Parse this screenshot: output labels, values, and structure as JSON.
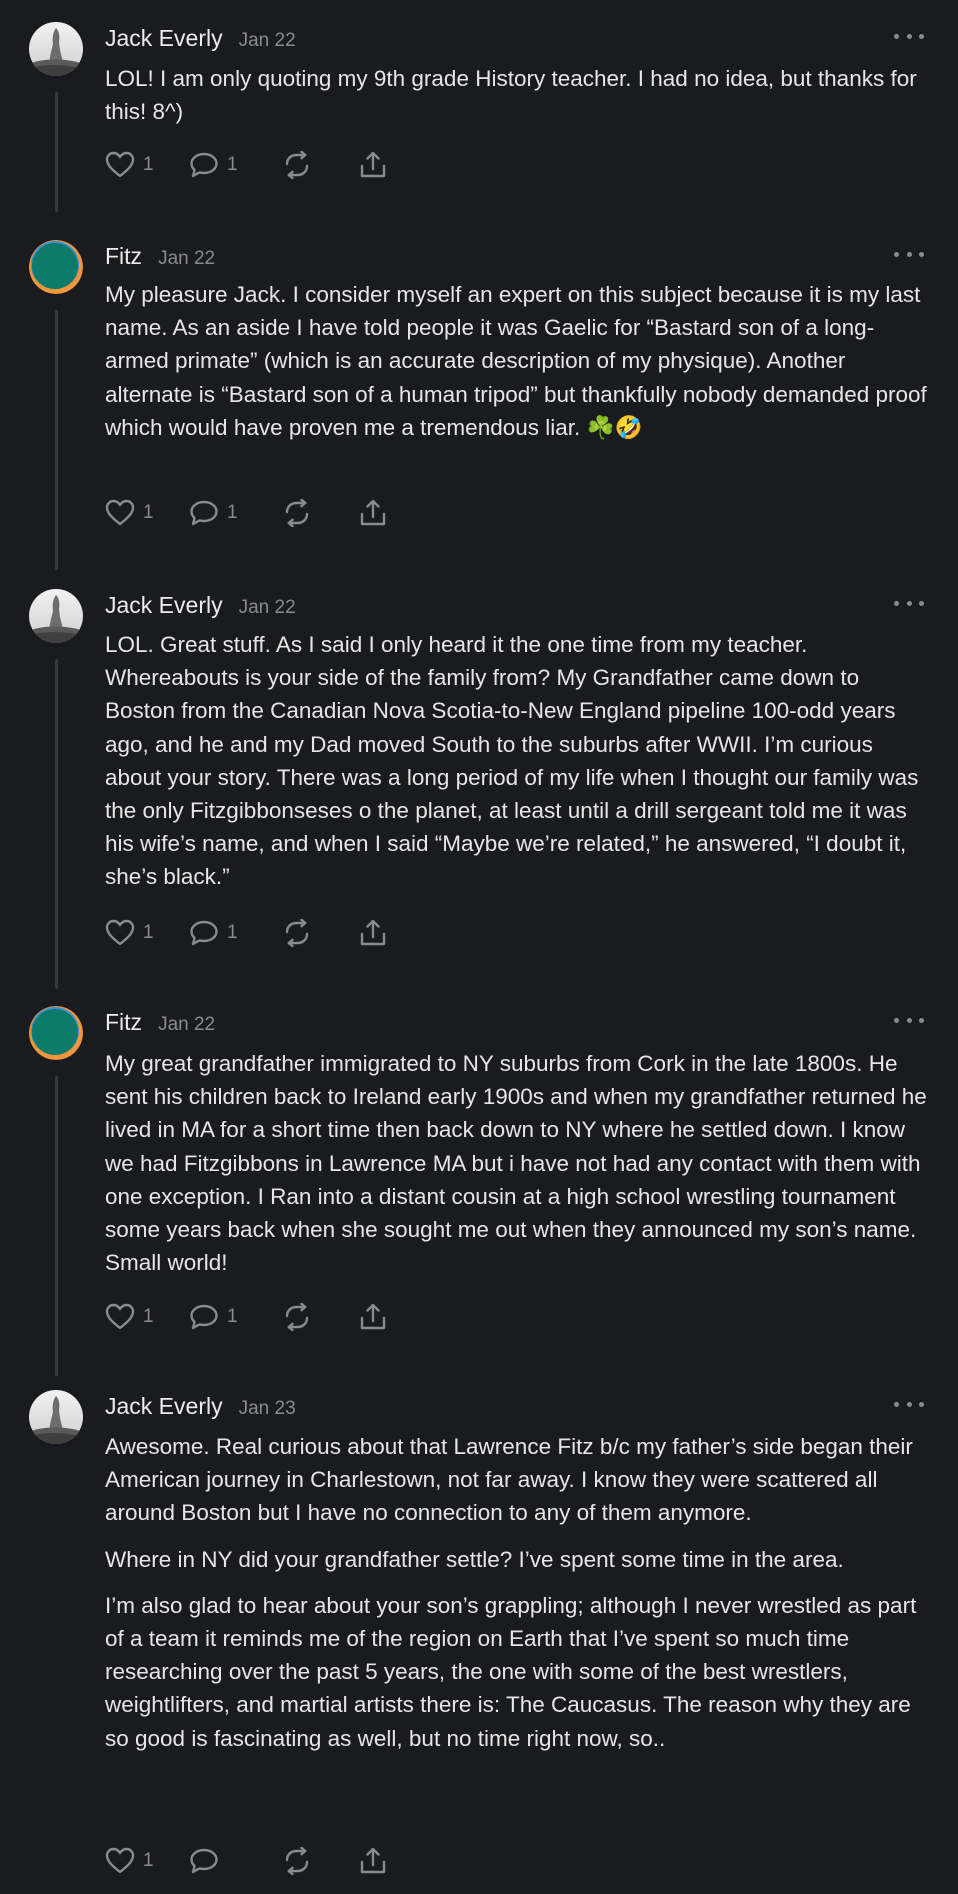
{
  "comments": [
    {
      "author": "Jack Everly",
      "date": "Jan 22",
      "avatar": "statue-photo",
      "paragraphs": [
        "LOL! I am only quoting my 9th grade History teacher. I had no idea, but thanks for this! 8^)"
      ],
      "like_count": "1",
      "reply_count": "1"
    },
    {
      "author": "Fitz",
      "date": "Jan 22",
      "avatar": "flag-circle",
      "paragraphs": [
        "My pleasure Jack. I consider myself an expert on this subject because it is my last name. As an aside I have told people it was Gaelic for “Bastard son of a long-armed primate” (which is an accurate description of my physique). Another alternate is “Bastard son of a human tripod” but thankfully nobody demanded proof which would have proven me a tremendous liar. ☘️🤣"
      ],
      "like_count": "1",
      "reply_count": "1"
    },
    {
      "author": "Jack Everly",
      "date": "Jan 22",
      "avatar": "statue-photo",
      "paragraphs": [
        "LOL. Great stuff. As I said I only heard it the one time from my teacher. Whereabouts is your side of the family from? My Grandfather came down to Boston from the Canadian Nova Scotia-to-New England pipeline 100-odd years ago, and he and my Dad moved South to the suburbs after WWII. I’m curious about your story. There was a long period of my life when I thought our family was the only Fitzgibbonseses o the planet, at least until a drill sergeant told me it was his wife’s name, and when I said “Maybe we’re related,” he answered, “I doubt it, she’s black.”"
      ],
      "like_count": "1",
      "reply_count": "1"
    },
    {
      "author": "Fitz",
      "date": "Jan 22",
      "avatar": "flag-circle",
      "paragraphs": [
        "My great grandfather immigrated to NY suburbs from Cork in the late 1800s. He sent his children back to Ireland early 1900s and when my grandfather returned he lived in MA for a short time then back down to NY where he settled down. I know we had Fitzgibbons in Lawrence MA but i have not had any contact with them with one exception. I Ran into a distant cousin at a high school wrestling tournament some years back when she sought me out when they announced my son’s name. Small world!"
      ],
      "like_count": "1",
      "reply_count": "1"
    },
    {
      "author": "Jack Everly",
      "date": "Jan 23",
      "avatar": "statue-photo",
      "paragraphs": [
        "Awesome. Real curious about that Lawrence Fitz b/c my father’s side began their American journey in Charlestown, not far away. I know they were scattered all around Boston but I have no connection to any of them anymore.",
        "Where in NY did your grandfather settle? I’ve spent some time in the area.",
        "I’m also glad to hear about your son’s grappling; although I never wrestled as part of a team it reminds me of the region on Earth that I’ve spent so much time researching over the past 5 years, the one with some of the best wrestlers, weightlifters, and martial artists there is: The Caucasus. The reason why they are so good is fascinating as well, but no time right now, so.."
      ],
      "like_count": "1",
      "reply_count": ""
    }
  ],
  "colors": {
    "background": "#1a1b1e",
    "text": "#e6e6e6",
    "muted": "#8a8b8f",
    "thread_line": "#3a3b3f",
    "avatar_teal": "#0e7a6a",
    "avatar_orange": "#f0963a",
    "avatar_blue": "#3a8fd6"
  },
  "icons": [
    "heart-icon",
    "comment-icon",
    "restack-icon",
    "share-icon",
    "more-icon"
  ]
}
